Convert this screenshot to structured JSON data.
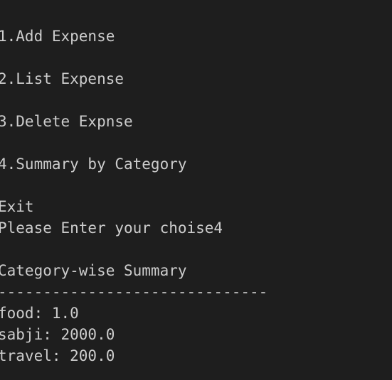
{
  "terminal": {
    "lines": [
      "1.Add Expense",
      "",
      "2.List Expense",
      "",
      "3.Delete Expnse",
      "",
      "4.Summary by Category",
      "",
      "Exit",
      "Please Enter your choise4",
      "",
      "Category-wise Summary",
      "------------------------------",
      "food: 1.0",
      "sabji: 2000.0",
      "travel: 200.0"
    ]
  },
  "colors": {
    "background": "#1e1e1e",
    "text": "#cccccc"
  }
}
